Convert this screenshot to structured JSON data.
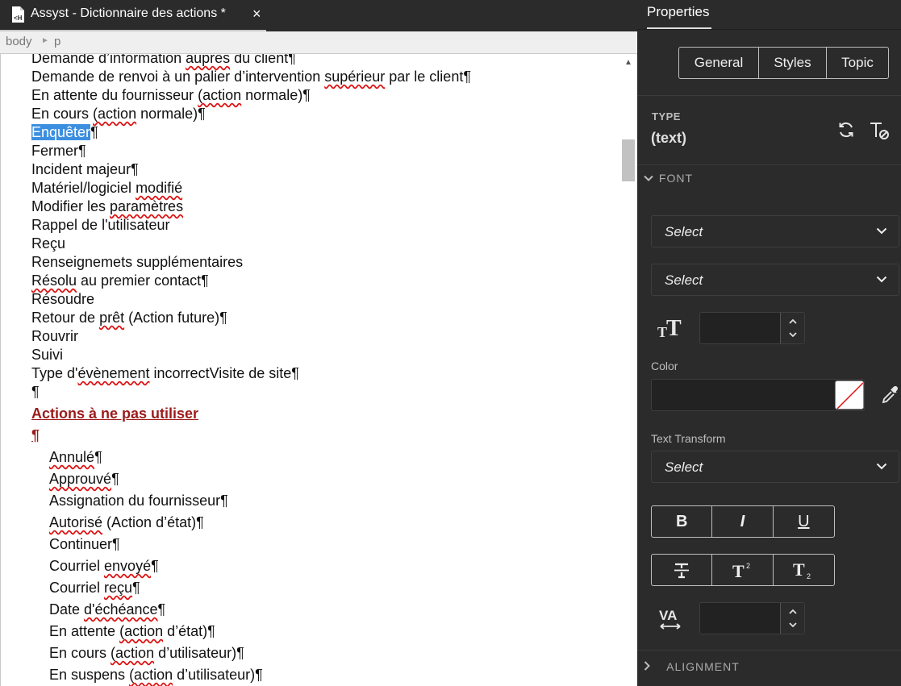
{
  "tab": {
    "title": "Assyst - Dictionnaire des actions *",
    "close": "×"
  },
  "breadcrumb": {
    "body": "body",
    "sep": "►",
    "p": "p"
  },
  "document": {
    "lines": [
      "Demande d’information auprès du client¶",
      "Demande de renvoi à un palier d’intervention supérieur par le client¶",
      "En attente du fournisseur (action normale)¶",
      "En cours (action normale)¶",
      "Enquêter",
      "Fermer¶",
      "Incident majeur¶",
      "Matériel/logiciel modifié",
      "Modifier les paramètres",
      "Rappel de l'utilisateur",
      "Reçu",
      "Renseignemets supplémentaires",
      "Résolu au premier contact¶",
      "Résoudre",
      "Retour de prêt (Action future)¶",
      "Rouvrir",
      "Suivi",
      "Type d'évènement incorrectVisite de site¶",
      "¶"
    ],
    "selected_pilcrow": "¶",
    "heading": "Actions à ne pas utiliser",
    "heading_pilcrow": "¶",
    "sublist": [
      "Annulé¶",
      "Approuvé¶",
      "Assignation du fournisseur¶",
      "Autorisé (Action d’état)¶",
      "Continuer¶",
      "Courriel envoyé¶",
      "Courriel reçu¶",
      "Date d'échéance¶",
      "En attente (action d’état)¶",
      "En cours (action d’utilisateur)¶",
      "En suspens (action d’utilisateur)¶"
    ]
  },
  "properties": {
    "tab": "Properties",
    "segments": [
      "General",
      "Styles",
      "Topic"
    ],
    "type_label": "TYPE",
    "type_value": "(text)",
    "font_section": "FONT",
    "font_family_select": "Select",
    "font_weight_select": "Select",
    "font_size_value": "",
    "color_label": "Color",
    "text_transform_label": "Text Transform",
    "text_transform_select": "Select",
    "bold": "B",
    "italic": "I",
    "underline": "U",
    "letter_spacing_value": "",
    "alignment_section": "ALIGNMENT"
  },
  "colors": {
    "selection": "#3c8fe0",
    "heading": "#9c1b1b",
    "panel_bg": "#2b2b2b",
    "spellcheck": "#dd1111"
  },
  "icons": [
    "document-icon",
    "refresh-icon",
    "clear-format-icon",
    "font-size-icon",
    "eyedropper-icon",
    "strikethrough-icon",
    "superscript-icon",
    "subscript-icon",
    "letter-spacing-icon",
    "chevron-down-icon",
    "chevron-right-icon"
  ]
}
